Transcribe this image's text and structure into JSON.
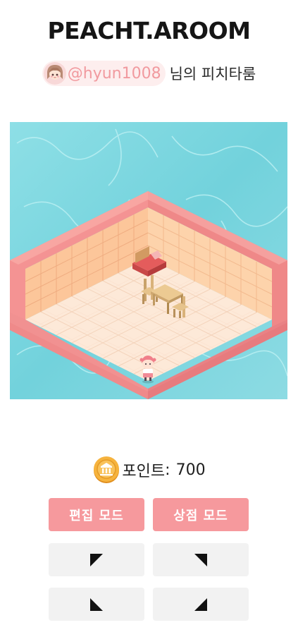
{
  "header": {
    "title": "PEACHT.AROOM"
  },
  "owner": {
    "handle": "@hyun1008",
    "suffix": "님의 피치타룸"
  },
  "points": {
    "label": "포인트",
    "separator": ":",
    "value": "700"
  },
  "controls": {
    "edit_mode_label": "편집 모드",
    "shop_mode_label": "상점 모드",
    "direction_buttons": [
      "up-left",
      "up-right",
      "down-left",
      "down-right"
    ]
  },
  "colors": {
    "accent_pink": "#f6999d",
    "handle_pink": "#f19a9f",
    "water": "#7fd6df",
    "wall": "#fcc79a",
    "floor": "#fdeada",
    "coin": "#f5b13b"
  },
  "icons": {
    "avatar": "character-avatar-icon",
    "coin": "coin-icon",
    "up_left": "arrow-up-left-icon",
    "up_right": "arrow-up-right-icon",
    "down_left": "arrow-down-left-icon",
    "down_right": "arrow-down-right-icon"
  }
}
